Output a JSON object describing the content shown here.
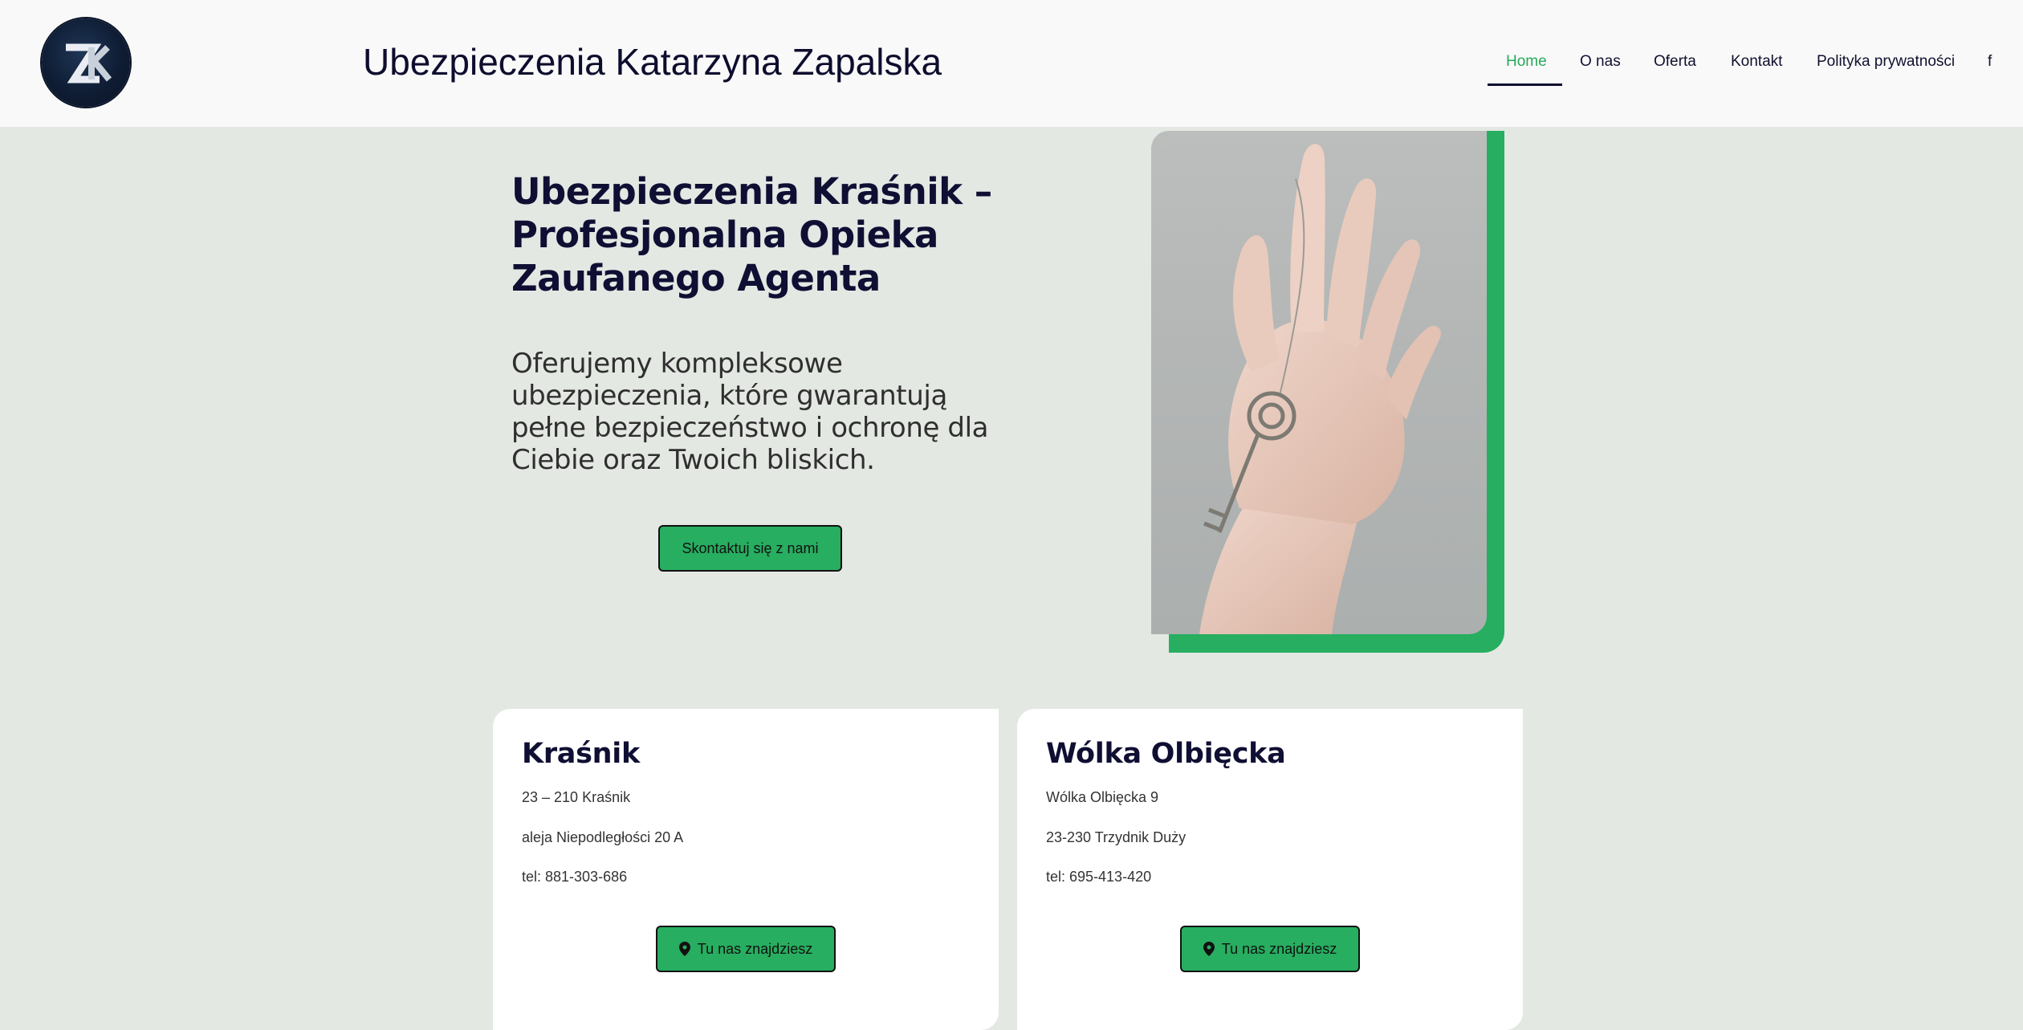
{
  "header": {
    "logo_icon": "zk-monogram-logo",
    "site_title": "Ubezpieczenia Katarzyna Zapalska",
    "nav": [
      {
        "label": "Home",
        "active": true
      },
      {
        "label": "O nas"
      },
      {
        "label": "Oferta"
      },
      {
        "label": "Kontakt"
      },
      {
        "label": "Polityka prywatności"
      },
      {
        "label": "f",
        "icon": "facebook-icon"
      }
    ]
  },
  "hero": {
    "title": "Ubezpieczenia Kraśnik – Profesjonalna Opieka Zaufanego Agenta",
    "subtitle": "Oferujemy kompleksowe ubezpieczenia, które gwarantują pełne bezpieczeństwo i ochronę dla Ciebie oraz Twoich bliskich.",
    "cta_label": "Skontaktuj się z nami",
    "image": "hand-holding-key-photo"
  },
  "locations": [
    {
      "name": "Kraśnik",
      "lines": [
        "23 – 210 Kraśnik",
        "aleja Niepodległości 20 A",
        "tel: 881-303-686"
      ],
      "button_label": "Tu nas znajdziesz",
      "button_icon": "map-pin-icon"
    },
    {
      "name": "Wólka Olbięcka",
      "lines": [
        "Wólka Olbięcka 9",
        "23-230 Trzydnik Duży",
        "tel: 695-413-420"
      ],
      "button_label": "Tu nas znajdziesz",
      "button_icon": "map-pin-icon"
    }
  ],
  "colors": {
    "accent_green": "#27ae60",
    "navy": "#0f0f33",
    "background": "#e4e8e3"
  }
}
